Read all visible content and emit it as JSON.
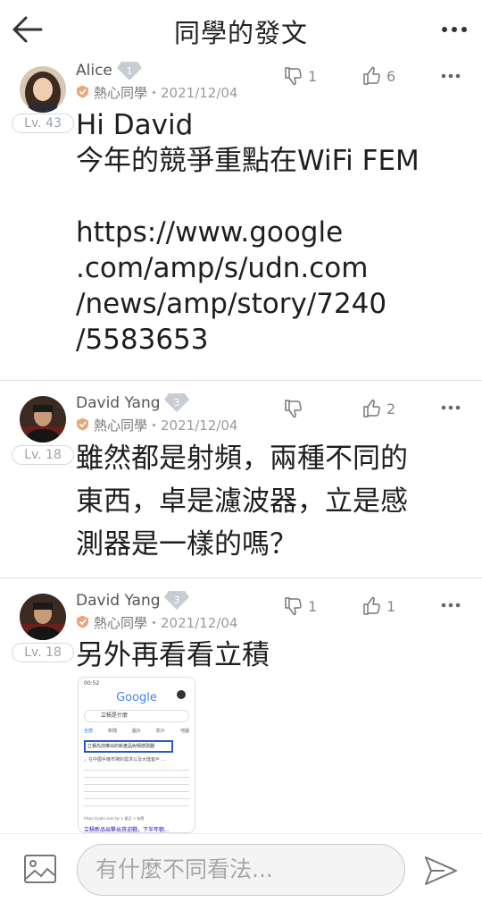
{
  "header": {
    "title": "同學的發文"
  },
  "posts": [
    {
      "author": "Alice",
      "level": "Lv. 43",
      "role": "熱心同學",
      "date": "・2021/12/04",
      "dislikes": "1",
      "likes": "6",
      "lines": [
        "Hi David",
        "今年的競爭重點在WiFi FEM",
        "",
        "https://www.google",
        ".com/amp/s/udn.com",
        "/news/amp/story/7240",
        "/5583653"
      ]
    },
    {
      "author": "David Yang",
      "level": "Lv. 18",
      "role": "熱心同學",
      "date": "・2021/12/04",
      "dislikes": "",
      "likes": "2",
      "lines": [
        "雖然都是射頻，兩種不同的",
        "東西，卓是濾波器，立是感",
        "測器是一樣的嗎？"
      ]
    },
    {
      "author": "David Yang",
      "level": "Lv. 18",
      "role": "熱心同學",
      "date": "・2021/12/04",
      "dislikes": "1",
      "likes": "1",
      "lines": [
        "另外再看看立積"
      ]
    }
  ],
  "screenshot": {
    "time": "00:52",
    "logo": "Google",
    "query": "立積是什麼",
    "tabs": [
      "全部",
      "新聞",
      "圖片",
      "影片",
      "地圖"
    ],
    "highlight": "立積先前推出的新產品射頻感測器",
    "snippet": "，在中國手機市場的需求以及大陸客戶 ...",
    "source": "https://yiaki.com.tw > 產品 > 新聞",
    "link": "立積新品出擊出貨迎戰，下半年朝..."
  },
  "composer": {
    "placeholder": "有什麼不同看法..."
  }
}
